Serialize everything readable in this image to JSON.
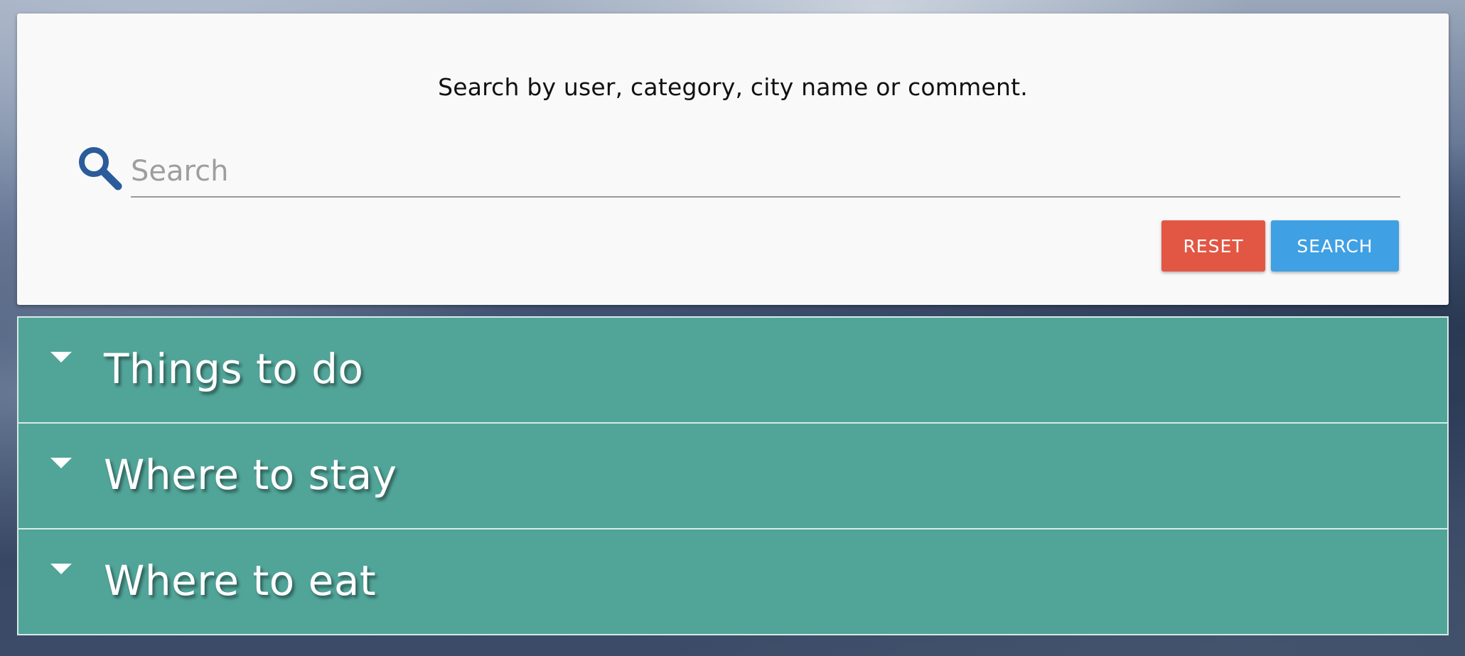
{
  "search": {
    "hint": "Search by user, category, city name or comment.",
    "placeholder": "Search",
    "value": "",
    "reset_label": "RESET",
    "search_label": "SEARCH",
    "icon": "search-icon"
  },
  "accordion": {
    "items": [
      {
        "label": "Things to do",
        "icon": "caret-down-icon"
      },
      {
        "label": "Where to stay",
        "icon": "caret-down-icon"
      },
      {
        "label": "Where to eat",
        "icon": "caret-down-icon"
      }
    ]
  },
  "colors": {
    "card_bg": "#f9f9f9",
    "icon_blue": "#2a5b9a",
    "reset_red": "#e25744",
    "search_blue": "#3fa0e3",
    "accordion_teal": "#51a498",
    "accordion_border": "#d6ebe7"
  }
}
